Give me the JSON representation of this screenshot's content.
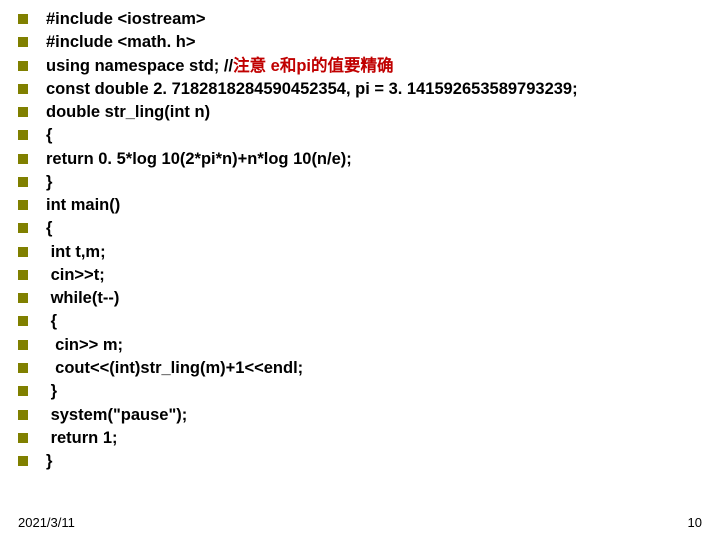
{
  "lines": [
    {
      "text": "#include <iostream>",
      "comment": ""
    },
    {
      "text": "#include <math. h>",
      "comment": ""
    },
    {
      "text": "using namespace std; //",
      "comment": "注意 e和pi的值要精确"
    },
    {
      "text": "const double 2. 7182818284590452354, pi = 3. 141592653589793239;",
      "comment": ""
    },
    {
      "text": "double str_ling(int n)",
      "comment": ""
    },
    {
      "text": "{",
      "comment": ""
    },
    {
      "text": "return 0. 5*log 10(2*pi*n)+n*log 10(n/e);",
      "comment": ""
    },
    {
      "text": "}",
      "comment": ""
    },
    {
      "text": "int main()",
      "comment": ""
    },
    {
      "text": "{",
      "comment": ""
    },
    {
      "text": " int t,m;",
      "comment": ""
    },
    {
      "text": " cin>>t;",
      "comment": ""
    },
    {
      "text": " while(t--)",
      "comment": ""
    },
    {
      "text": " {",
      "comment": ""
    },
    {
      "text": "  cin>> m;",
      "comment": ""
    },
    {
      "text": "  cout<<(int)str_ling(m)+1<<endl;",
      "comment": ""
    },
    {
      "text": " }",
      "comment": ""
    },
    {
      "text": " system(\"pause\");",
      "comment": ""
    },
    {
      "text": " return 1;",
      "comment": ""
    },
    {
      "text": "}",
      "comment": ""
    }
  ],
  "footer": {
    "date": "2021/3/11",
    "page": "10"
  }
}
